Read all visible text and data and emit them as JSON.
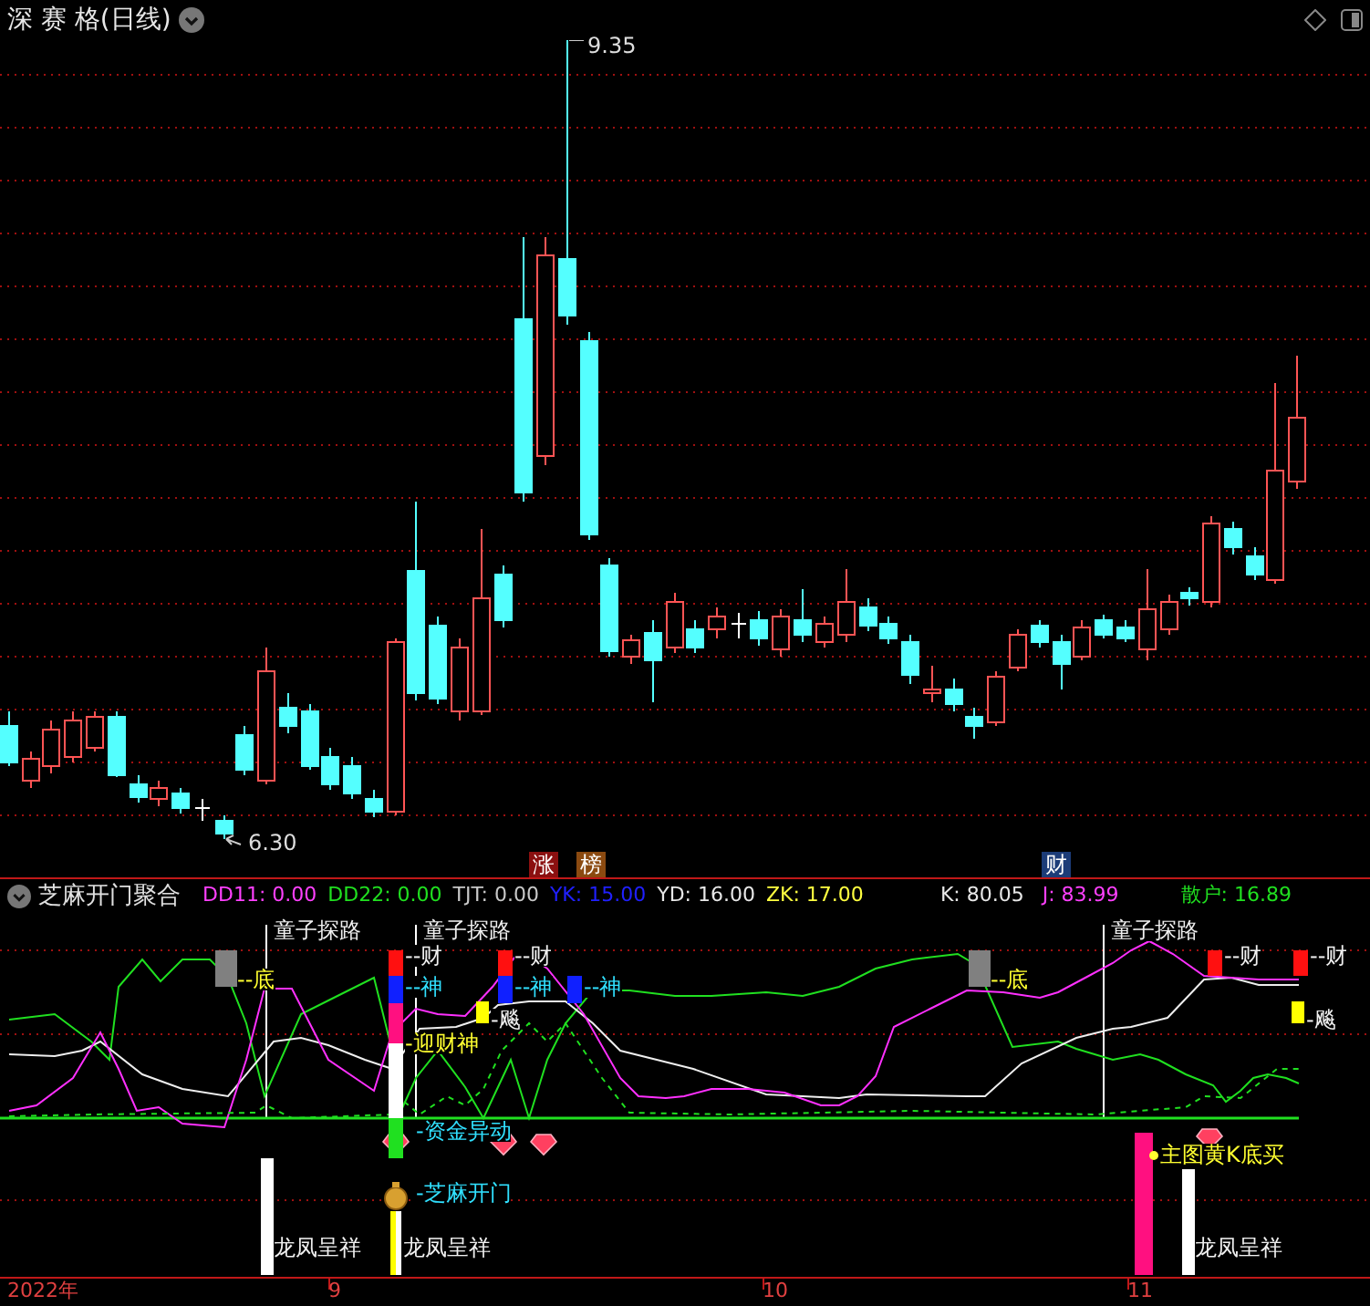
{
  "header": {
    "title": "深 赛 格(日线)"
  },
  "price_chart": {
    "high_label": "9.35",
    "low_label": "6.30",
    "markers": [
      {
        "text": "涨",
        "color": "#8b1010"
      },
      {
        "text": "榜",
        "color": "#8b4a10"
      },
      {
        "text": "财",
        "color": "#1c3c78"
      }
    ]
  },
  "indicator": {
    "name": "芝麻开门聚合",
    "readings": [
      {
        "text": "DD11: 0.00",
        "color": "#ff40ff"
      },
      {
        "text": "DD22: 0.00",
        "color": "#20e020"
      },
      {
        "text": "TJT: 0.00",
        "color": "#c8c8c8"
      },
      {
        "text": "YK: 15.00",
        "color": "#2020ff"
      },
      {
        "text": "YD: 16.00",
        "color": "#e8e8e8"
      },
      {
        "text": "ZK: 17.00",
        "color": "#ffff40"
      },
      {
        "text": "K: 80.05",
        "color": "#e8e8e8"
      },
      {
        "text": "J: 83.99",
        "color": "#ff40ff"
      },
      {
        "text": "散户: 16.89",
        "color": "#20e020"
      }
    ]
  },
  "signals": [
    {
      "kind": "probe",
      "text": "童子探路"
    },
    {
      "kind": "probe",
      "text": "童子探路"
    },
    {
      "kind": "probe",
      "text": "童子探路"
    },
    {
      "kind": "bottom",
      "text": "--底"
    },
    {
      "kind": "wealth",
      "text": "--财"
    },
    {
      "kind": "god",
      "text": "--神"
    },
    {
      "kind": "welcome",
      "text": "-迎财神"
    },
    {
      "kind": "wealth",
      "text": "--财"
    },
    {
      "kind": "god",
      "text": "--神"
    },
    {
      "kind": "surge",
      "text": "-飚"
    },
    {
      "kind": "god",
      "text": "--神"
    },
    {
      "kind": "bottom",
      "text": "--底"
    },
    {
      "kind": "wealth",
      "text": "--财"
    },
    {
      "kind": "wealth",
      "text": "--财"
    },
    {
      "kind": "surge",
      "text": "-飚"
    },
    {
      "kind": "fund",
      "text": "-资金异动"
    },
    {
      "kind": "open",
      "text": "-芝麻开门"
    },
    {
      "kind": "dragon",
      "text": "龙凤呈祥"
    },
    {
      "kind": "dragon",
      "text": "龙凤呈祥"
    },
    {
      "kind": "buy",
      "text": "主图黄K底买"
    },
    {
      "kind": "dragon",
      "text": "龙凤呈祥"
    }
  ],
  "x_axis": {
    "labels": [
      "2022年",
      "9",
      "10",
      "11"
    ]
  }
}
